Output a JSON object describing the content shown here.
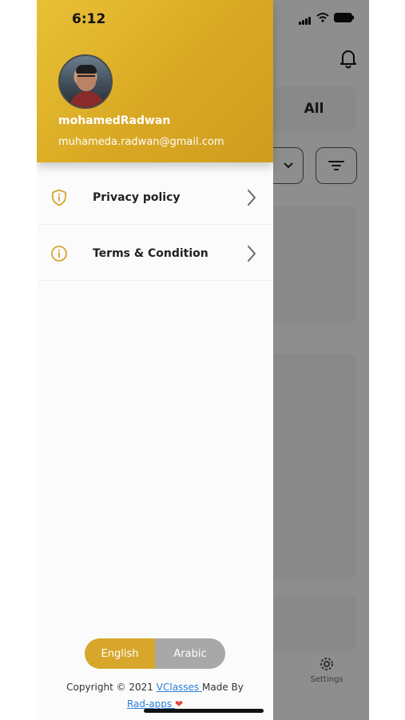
{
  "status_bar": {
    "time": "6:12"
  },
  "user": {
    "name": "mohamedRadwan",
    "email": "muhameda.radwan@gmail.com"
  },
  "menu": {
    "items": [
      {
        "label": "Privacy policy",
        "icon": "shield-info-icon"
      },
      {
        "label": "Terms & Condition",
        "icon": "info-circle-icon"
      }
    ]
  },
  "language": {
    "english": "English",
    "arabic": "Arabic",
    "selected": "English"
  },
  "footer": {
    "prefix": "Copyright © 2021 ",
    "brand": "VClasses ",
    "made_by": "Made By",
    "author": "Rad-apps ",
    "heart": "❤"
  },
  "background_app": {
    "filter_all": "All",
    "settings_label": "Settings"
  },
  "colors": {
    "accent": "#d7a62a",
    "header_gradient_start": "#e8c136",
    "header_gradient_end": "#cf9d1e",
    "link": "#2f7fd9"
  }
}
